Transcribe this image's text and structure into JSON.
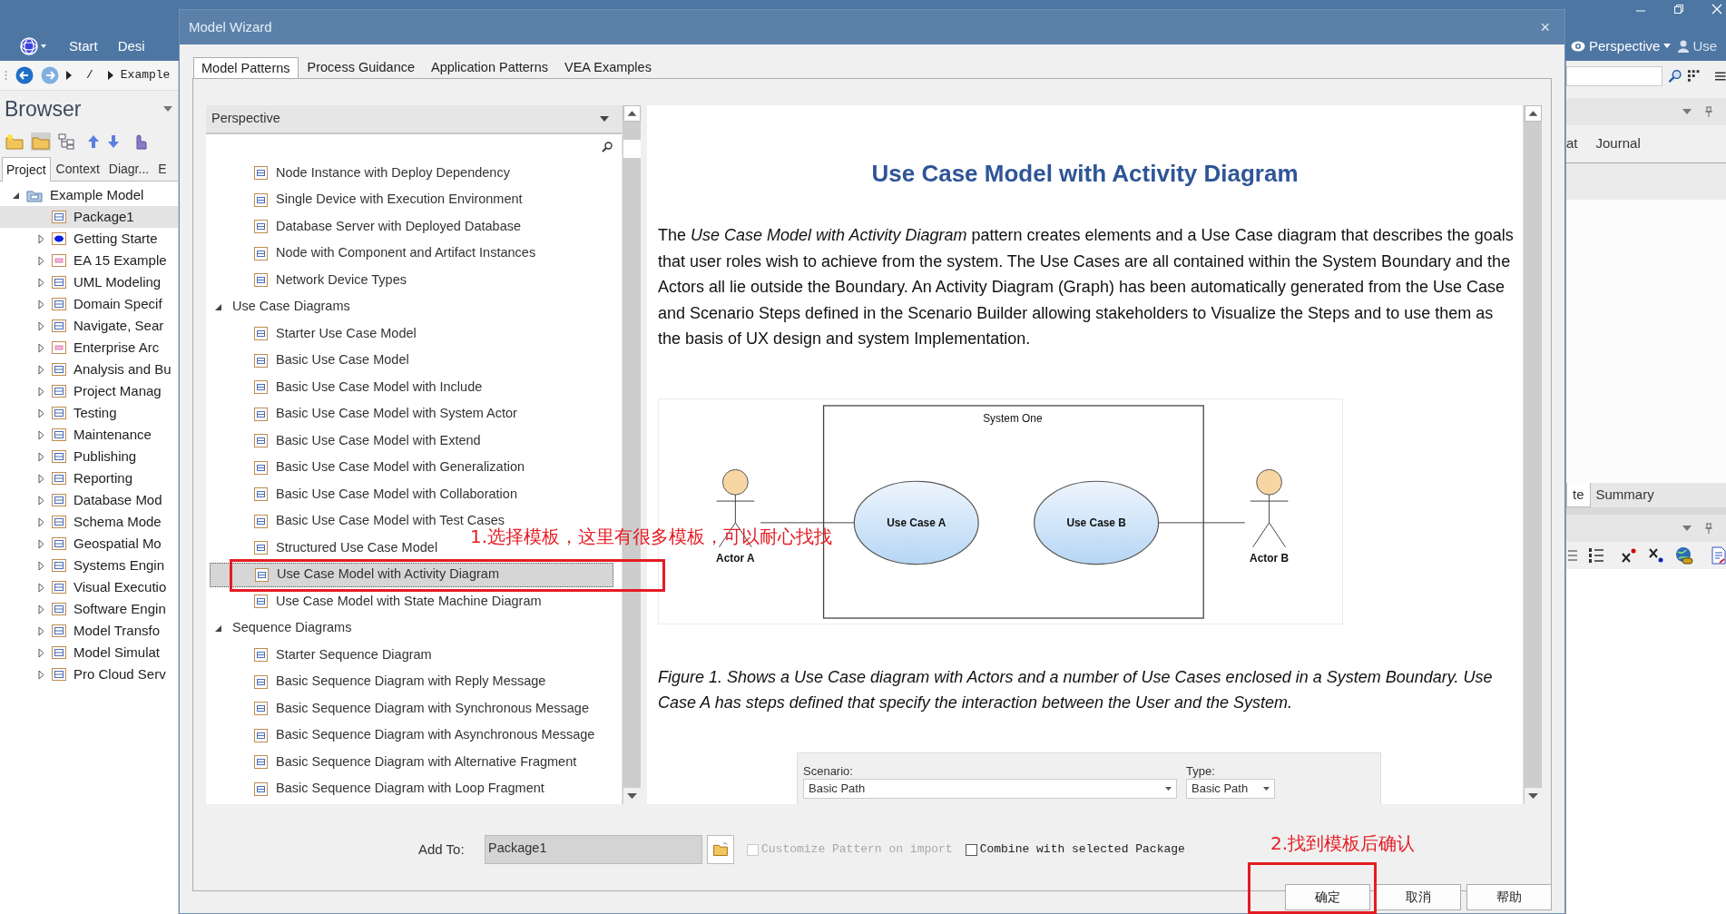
{
  "app": {
    "menu": [
      {
        "label": "Start"
      },
      {
        "label": "Desi"
      }
    ],
    "path": [
      "/",
      "Example"
    ],
    "perspective": "Perspective",
    "user": "Use"
  },
  "browser": {
    "title": "Browser",
    "tabs": [
      {
        "label": "Project",
        "selected": true
      },
      {
        "label": "Context",
        "selected": false
      },
      {
        "label": "Diagr...",
        "selected": false
      },
      {
        "label": "E",
        "selected": false
      }
    ],
    "tree": [
      {
        "label": "Example Model",
        "kind": "model",
        "expanded": true,
        "selected": false,
        "children": [
          {
            "label": "Package1",
            "kind": "package",
            "selected": true
          },
          {
            "label": "Getting Starte",
            "kind": "start",
            "expanded": false,
            "selected": false
          },
          {
            "label": "EA 15 Example",
            "kind": "pink",
            "expanded": false,
            "selected": false
          },
          {
            "label": "UML Modeling",
            "kind": "package",
            "expanded": false,
            "selected": false
          },
          {
            "label": "Domain Specif",
            "kind": "package",
            "expanded": false,
            "selected": false
          },
          {
            "label": "Navigate, Sear",
            "kind": "package",
            "expanded": false,
            "selected": false
          },
          {
            "label": "Enterprise Arc",
            "kind": "pink",
            "expanded": false,
            "selected": false
          },
          {
            "label": "Analysis and Bu",
            "kind": "package",
            "expanded": false,
            "selected": false
          },
          {
            "label": "Project Manag",
            "kind": "package",
            "expanded": false,
            "selected": false
          },
          {
            "label": "Testing",
            "kind": "package",
            "expanded": false,
            "selected": false
          },
          {
            "label": "Maintenance",
            "kind": "package",
            "expanded": false,
            "selected": false
          },
          {
            "label": "Publishing",
            "kind": "package",
            "expanded": false,
            "selected": false
          },
          {
            "label": "Reporting",
            "kind": "package",
            "expanded": false,
            "selected": false
          },
          {
            "label": "Database Mod",
            "kind": "package",
            "expanded": false,
            "selected": false
          },
          {
            "label": "Schema Mode",
            "kind": "package",
            "expanded": false,
            "selected": false
          },
          {
            "label": "Geospatial Mo",
            "kind": "package",
            "expanded": false,
            "selected": false
          },
          {
            "label": "Systems Engin",
            "kind": "package",
            "expanded": false,
            "selected": false
          },
          {
            "label": "Visual Executio",
            "kind": "package",
            "expanded": false,
            "selected": false
          },
          {
            "label": "Software Engin",
            "kind": "package",
            "expanded": false,
            "selected": false
          },
          {
            "label": "Model Transfo",
            "kind": "package",
            "expanded": false,
            "selected": false
          },
          {
            "label": "Model Simulat",
            "kind": "package",
            "expanded": false,
            "selected": false
          },
          {
            "label": "Pro Cloud Serv",
            "kind": "package",
            "expanded": false,
            "selected": false
          }
        ]
      }
    ]
  },
  "side_panel": {
    "top_tabs": [
      "at",
      "Journal"
    ],
    "bottom_tabs": [
      {
        "label": "te",
        "selected": true
      },
      {
        "label": "Summary",
        "selected": false
      }
    ]
  },
  "dialog": {
    "title": "Model Wizard",
    "close": "×",
    "tabs": [
      {
        "label": "Model Patterns",
        "selected": true
      },
      {
        "label": "Process Guidance",
        "selected": false
      },
      {
        "label": "Application Patterns",
        "selected": false
      },
      {
        "label": "VEA Examples",
        "selected": false
      }
    ],
    "perspective": "Perspective",
    "patterns": [
      {
        "label": "Node Instance with Deploy Dependency",
        "selected": false
      },
      {
        "label": "Single Device with Execution Environment",
        "selected": false
      },
      {
        "label": "Database Server with Deployed Database",
        "selected": false
      },
      {
        "label": "Node with Component and Artifact Instances",
        "selected": false
      },
      {
        "label": "Network Device Types",
        "selected": false
      },
      {
        "label": "Use Case Diagrams",
        "selected": false,
        "expanded": true,
        "children": [
          {
            "label": "Starter Use Case Model",
            "selected": false
          },
          {
            "label": "Basic Use Case Model",
            "selected": false
          },
          {
            "label": "Basic Use Case Model with Include",
            "selected": false
          },
          {
            "label": "Basic Use Case Model with System Actor",
            "selected": false
          },
          {
            "label": "Basic Use Case Model with Extend",
            "selected": false
          },
          {
            "label": "Basic Use Case Model with Generalization",
            "selected": false
          },
          {
            "label": "Basic Use Case Model with Collaboration",
            "selected": false
          },
          {
            "label": "Basic Use Case Model with Test Cases",
            "selected": false
          },
          {
            "label": "Structured Use Case Model",
            "selected": false
          },
          {
            "label": "Use Case Model with Activity Diagram",
            "selected": true
          },
          {
            "label": "Use Case Model with State Machine Diagram",
            "selected": false
          }
        ]
      },
      {
        "label": "Sequence Diagrams",
        "selected": false,
        "expanded": true,
        "children": [
          {
            "label": "Starter Sequence Diagram",
            "selected": false
          },
          {
            "label": "Basic Sequence Diagram with Reply Message",
            "selected": false
          },
          {
            "label": "Basic Sequence Diagram with Synchronous Message",
            "selected": false
          },
          {
            "label": "Basic Sequence Diagram with Asynchronous Message",
            "selected": false
          },
          {
            "label": "Basic Sequence Diagram with Alternative Fragment",
            "selected": false
          },
          {
            "label": "Basic Sequence Diagram with Loop Fragment",
            "selected": false
          }
        ]
      }
    ],
    "detail": {
      "title": "Use Case Model with Activity Diagram",
      "description": "The *Use Case Model with Activity Diagram* pattern creates elements and a Use Case diagram that describes the goals that user roles wish to achieve from the system. The Use Cases are all contained within the System Boundary and the Actors all lie outside the Boundary. An Activity Diagram (Graph) has been automatically generated from the Use Case and Scenario Steps defined in the Scenario Builder allowing stakeholders to Visualize the Steps and to use them as the basis of UX design and system Implementation.",
      "diagram": {
        "boundary": "System One",
        "use_cases": [
          "Use Case A",
          "Use Case B"
        ],
        "actors": [
          "Actor A",
          "Actor B"
        ]
      },
      "caption": "Figure 1. Shows a Use Case diagram with Actors and a number of Use Cases enclosed in a System Boundary. Use Case A has steps defined that specify the interaction between the User and the System.",
      "scenario": {
        "label": "Scenario:",
        "value": "Basic Path",
        "type_label": "Type:",
        "type_value": "Basic Path"
      }
    },
    "add_to": {
      "label": "Add To:",
      "value": "Package1"
    },
    "options": [
      {
        "label": "Customize Pattern on import",
        "checked": false,
        "disabled": true
      },
      {
        "label": "Combine with selected Package",
        "checked": false,
        "disabled": false
      }
    ],
    "buttons": [
      "确定",
      "取消",
      "帮助"
    ]
  },
  "annotations": [
    {
      "text": "1.选择模板，这里有很多模板，可以耐心找找"
    },
    {
      "text": "2.找到模板后确认"
    }
  ]
}
